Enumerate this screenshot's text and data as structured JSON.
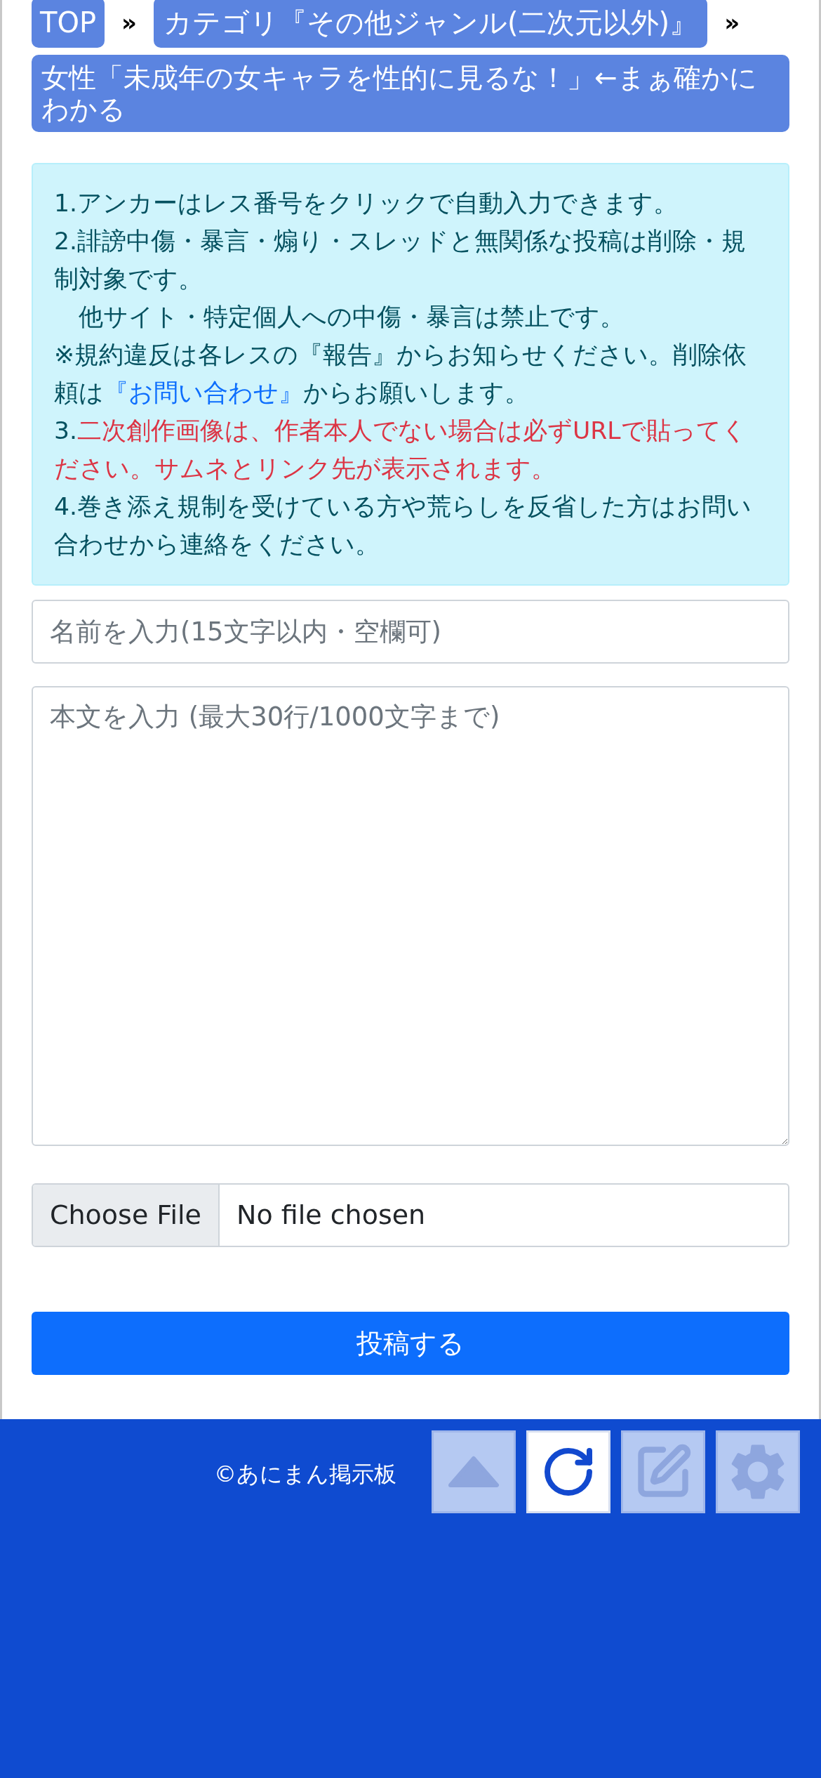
{
  "breadcrumbs": [
    {
      "label": "TOP"
    },
    {
      "label": "カテゴリ『その他ジャンル(二次元以外)』"
    }
  ],
  "separators": [
    "»",
    "»"
  ],
  "thread_title": "女性「未成年の女キャラを性的に見るな！」←まぁ確かにわかる",
  "notice": [
    {
      "kind": "plain",
      "text": "1.アンカーはレス番号をクリックで自動入力できます。"
    },
    {
      "kind": "plain",
      "text": "2.誹謗中傷・暴言・煽り・スレッドと無関係な投稿は削除・規制対象です。"
    },
    {
      "kind": "plain",
      "text": "　他サイト・特定個人への中傷・暴言は禁止です。"
    },
    {
      "kind": "link",
      "before": "※規約違反は各レスの『報告』からお知らせください。削除依頼は",
      "link": "『お問い合わせ』",
      "after": "からお願いします。"
    },
    {
      "kind": "warning",
      "prefix": "3.",
      "text": "二次創作画像は、作者本人でない場合は必ずURLで貼ってください。サムネとリンク先が表示されます。"
    },
    {
      "kind": "plain",
      "text": "4.巻き添え規制を受けている方や荒らしを反省した方はお問い合わせから連絡をください。"
    }
  ],
  "name_field": {
    "placeholder": "名前を入力(15文字以内・空欄可)"
  },
  "body_field": {
    "placeholder": "本文を入力 (最大30行/1000文字まで)"
  },
  "file_picker": {
    "button": "Choose File",
    "status": "No file chosen"
  },
  "submit": "投稿する",
  "footer": {
    "copyright": "©あにまん掲示板"
  },
  "floating_buttons": [
    {
      "kind": "top",
      "active": false
    },
    {
      "kind": "reload",
      "active": true
    },
    {
      "kind": "write",
      "active": false
    },
    {
      "kind": "settings",
      "active": false
    }
  ]
}
